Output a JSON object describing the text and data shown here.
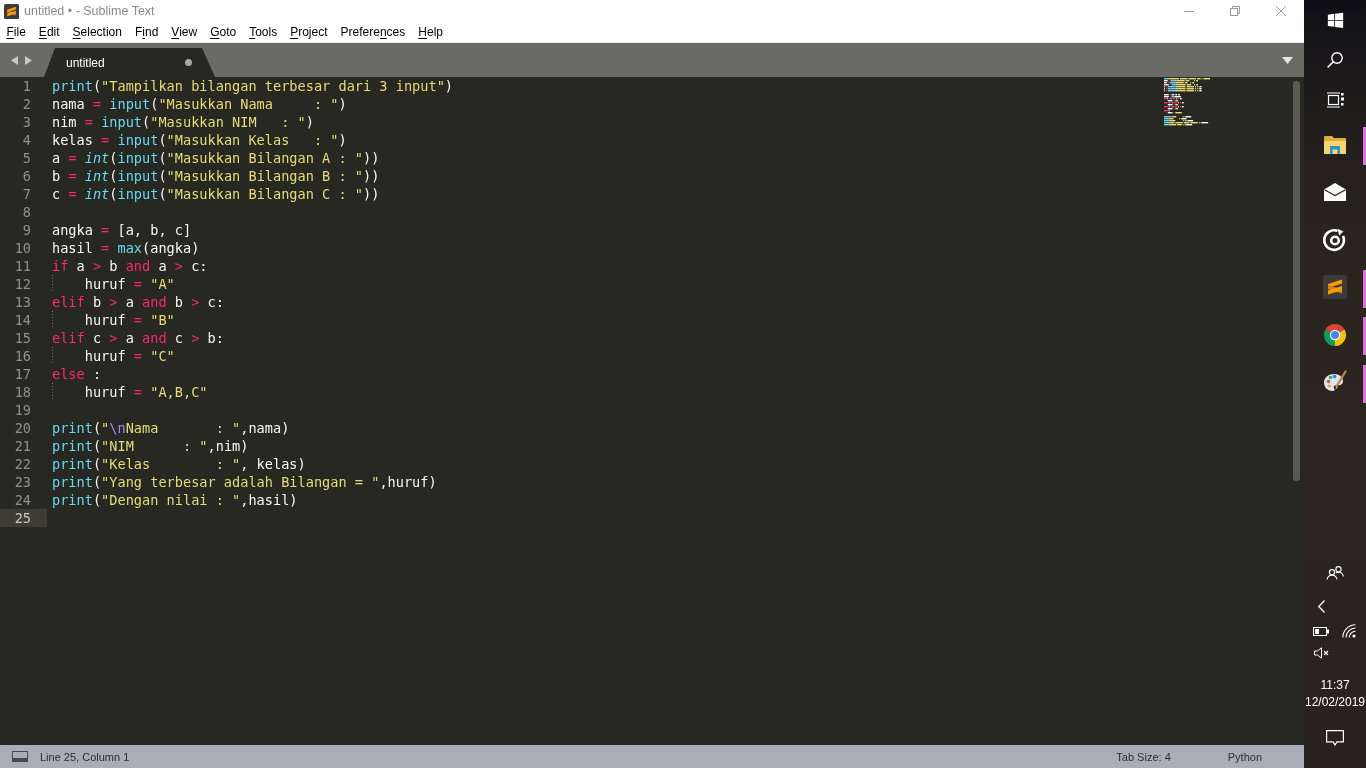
{
  "window": {
    "title": "untitled • - Sublime Text"
  },
  "menu": [
    {
      "key": "F",
      "post": "ile"
    },
    {
      "key": "E",
      "post": "dit"
    },
    {
      "key": "S",
      "post": "election"
    },
    {
      "pre": "F",
      "key": "i",
      "post": "nd"
    },
    {
      "key": "V",
      "post": "iew"
    },
    {
      "key": "G",
      "post": "oto"
    },
    {
      "key": "T",
      "post": "ools"
    },
    {
      "key": "P",
      "post": "roject"
    },
    {
      "pre": "Prefere",
      "key": "n",
      "post": "ces"
    },
    {
      "key": "H",
      "post": "elp"
    }
  ],
  "tabs": [
    {
      "label": "untitled",
      "selected": true,
      "dirty": true
    }
  ],
  "editor": {
    "lines": [
      {
        "number": "1",
        "current": false,
        "guide": false,
        "tokens": [
          {
            "kind": "function",
            "text": "print"
          },
          {
            "kind": "plain",
            "text": "("
          },
          {
            "kind": "string",
            "text": "\"Tampilkan bilangan terbesar dari 3 input\""
          },
          {
            "kind": "plain",
            "text": ")"
          }
        ]
      },
      {
        "number": "2",
        "current": false,
        "guide": false,
        "tokens": [
          {
            "kind": "plain",
            "text": "nama "
          },
          {
            "kind": "operator",
            "text": "= "
          },
          {
            "kind": "function",
            "text": "input"
          },
          {
            "kind": "plain",
            "text": "("
          },
          {
            "kind": "string",
            "text": "\"Masukkan Nama     : \""
          },
          {
            "kind": "plain",
            "text": ")"
          }
        ]
      },
      {
        "number": "3",
        "current": false,
        "guide": false,
        "tokens": [
          {
            "kind": "plain",
            "text": "nim "
          },
          {
            "kind": "operator",
            "text": "= "
          },
          {
            "kind": "function",
            "text": "input"
          },
          {
            "kind": "plain",
            "text": "("
          },
          {
            "kind": "string",
            "text": "\"Masukkan NIM   : \""
          },
          {
            "kind": "plain",
            "text": ")"
          }
        ]
      },
      {
        "number": "4",
        "current": false,
        "guide": false,
        "tokens": [
          {
            "kind": "plain",
            "text": "kelas "
          },
          {
            "kind": "operator",
            "text": "= "
          },
          {
            "kind": "function",
            "text": "input"
          },
          {
            "kind": "plain",
            "text": "("
          },
          {
            "kind": "string",
            "text": "\"Masukkan Kelas   : \""
          },
          {
            "kind": "plain",
            "text": ")"
          }
        ]
      },
      {
        "number": "5",
        "current": false,
        "guide": false,
        "tokens": [
          {
            "kind": "plain",
            "text": "a "
          },
          {
            "kind": "operator",
            "text": "= "
          },
          {
            "kind": "type",
            "text": "int"
          },
          {
            "kind": "plain",
            "text": "("
          },
          {
            "kind": "function",
            "text": "input"
          },
          {
            "kind": "plain",
            "text": "("
          },
          {
            "kind": "string",
            "text": "\"Masukkan Bilangan A : \""
          },
          {
            "kind": "plain",
            "text": "))"
          }
        ]
      },
      {
        "number": "6",
        "current": false,
        "guide": false,
        "tokens": [
          {
            "kind": "plain",
            "text": "b "
          },
          {
            "kind": "operator",
            "text": "= "
          },
          {
            "kind": "type",
            "text": "int"
          },
          {
            "kind": "plain",
            "text": "("
          },
          {
            "kind": "function",
            "text": "input"
          },
          {
            "kind": "plain",
            "text": "("
          },
          {
            "kind": "string",
            "text": "\"Masukkan Bilangan B : \""
          },
          {
            "kind": "plain",
            "text": "))"
          }
        ]
      },
      {
        "number": "7",
        "current": false,
        "guide": false,
        "tokens": [
          {
            "kind": "plain",
            "text": "c "
          },
          {
            "kind": "operator",
            "text": "= "
          },
          {
            "kind": "type",
            "text": "int"
          },
          {
            "kind": "plain",
            "text": "("
          },
          {
            "kind": "function",
            "text": "input"
          },
          {
            "kind": "plain",
            "text": "("
          },
          {
            "kind": "string",
            "text": "\"Masukkan Bilangan C : \""
          },
          {
            "kind": "plain",
            "text": "))"
          }
        ]
      },
      {
        "number": "8",
        "current": false,
        "guide": false
      },
      {
        "number": "9",
        "current": false,
        "guide": false,
        "tokens": [
          {
            "kind": "plain",
            "text": "angka "
          },
          {
            "kind": "operator",
            "text": "="
          },
          {
            "kind": "plain",
            "text": " [a, b, c]"
          }
        ]
      },
      {
        "number": "10",
        "current": false,
        "guide": false,
        "tokens": [
          {
            "kind": "plain",
            "text": "hasil "
          },
          {
            "kind": "operator",
            "text": "= "
          },
          {
            "kind": "function",
            "text": "max"
          },
          {
            "kind": "plain",
            "text": "(angka)"
          }
        ]
      },
      {
        "number": "11",
        "current": false,
        "guide": false,
        "tokens": [
          {
            "kind": "keyword",
            "text": "if"
          },
          {
            "kind": "plain",
            "text": " a "
          },
          {
            "kind": "operator",
            "text": ">"
          },
          {
            "kind": "plain",
            "text": " b "
          },
          {
            "kind": "keyword",
            "text": "and"
          },
          {
            "kind": "plain",
            "text": " a "
          },
          {
            "kind": "operator",
            "text": ">"
          },
          {
            "kind": "plain",
            "text": " c:"
          }
        ]
      },
      {
        "number": "12",
        "current": false,
        "guide": true,
        "tokens": [
          {
            "kind": "plain",
            "text": "    huruf "
          },
          {
            "kind": "operator",
            "text": "= "
          },
          {
            "kind": "string",
            "text": "\"A\""
          }
        ]
      },
      {
        "number": "13",
        "current": false,
        "guide": false,
        "tokens": [
          {
            "kind": "keyword",
            "text": "elif"
          },
          {
            "kind": "plain",
            "text": " b "
          },
          {
            "kind": "operator",
            "text": ">"
          },
          {
            "kind": "plain",
            "text": " a "
          },
          {
            "kind": "keyword",
            "text": "and"
          },
          {
            "kind": "plain",
            "text": " b "
          },
          {
            "kind": "operator",
            "text": ">"
          },
          {
            "kind": "plain",
            "text": " c:"
          }
        ]
      },
      {
        "number": "14",
        "current": false,
        "guide": true,
        "tokens": [
          {
            "kind": "plain",
            "text": "    huruf "
          },
          {
            "kind": "operator",
            "text": "= "
          },
          {
            "kind": "string",
            "text": "\"B\""
          }
        ]
      },
      {
        "number": "15",
        "current": false,
        "guide": false,
        "tokens": [
          {
            "kind": "keyword",
            "text": "elif"
          },
          {
            "kind": "plain",
            "text": " c "
          },
          {
            "kind": "operator",
            "text": ">"
          },
          {
            "kind": "plain",
            "text": " a "
          },
          {
            "kind": "keyword",
            "text": "and"
          },
          {
            "kind": "plain",
            "text": " c "
          },
          {
            "kind": "operator",
            "text": ">"
          },
          {
            "kind": "plain",
            "text": " b:"
          }
        ]
      },
      {
        "number": "16",
        "current": false,
        "guide": true,
        "tokens": [
          {
            "kind": "plain",
            "text": "    huruf "
          },
          {
            "kind": "operator",
            "text": "= "
          },
          {
            "kind": "string",
            "text": "\"C\""
          }
        ]
      },
      {
        "number": "17",
        "current": false,
        "guide": false,
        "tokens": [
          {
            "kind": "keyword",
            "text": "else"
          },
          {
            "kind": "plain",
            "text": " :"
          }
        ]
      },
      {
        "number": "18",
        "current": false,
        "guide": true,
        "tokens": [
          {
            "kind": "plain",
            "text": "    huruf "
          },
          {
            "kind": "operator",
            "text": "= "
          },
          {
            "kind": "string",
            "text": "\"A,B,C\""
          }
        ]
      },
      {
        "number": "19",
        "current": false,
        "guide": false
      },
      {
        "number": "20",
        "current": false,
        "guide": false,
        "tokens": [
          {
            "kind": "function",
            "text": "print"
          },
          {
            "kind": "plain",
            "text": "("
          },
          {
            "kind": "string",
            "text": "\""
          },
          {
            "kind": "escape",
            "text": "\\n"
          },
          {
            "kind": "string",
            "text": "Nama       : \""
          },
          {
            "kind": "plain",
            "text": ",nama)"
          }
        ]
      },
      {
        "number": "21",
        "current": false,
        "guide": false,
        "tokens": [
          {
            "kind": "function",
            "text": "print"
          },
          {
            "kind": "plain",
            "text": "("
          },
          {
            "kind": "string",
            "text": "\"NIM      : \""
          },
          {
            "kind": "plain",
            "text": ",nim)"
          }
        ]
      },
      {
        "number": "22",
        "current": false,
        "guide": false,
        "tokens": [
          {
            "kind": "function",
            "text": "print"
          },
          {
            "kind": "plain",
            "text": "("
          },
          {
            "kind": "string",
            "text": "\"Kelas        : \""
          },
          {
            "kind": "plain",
            "text": ", kelas)"
          }
        ]
      },
      {
        "number": "23",
        "current": false,
        "guide": false,
        "tokens": [
          {
            "kind": "function",
            "text": "print"
          },
          {
            "kind": "plain",
            "text": "("
          },
          {
            "kind": "string",
            "text": "\"Yang terbesar adalah Bilangan = \""
          },
          {
            "kind": "plain",
            "text": ",huruf)"
          }
        ]
      },
      {
        "number": "24",
        "current": false,
        "guide": false,
        "tokens": [
          {
            "kind": "function",
            "text": "print"
          },
          {
            "kind": "plain",
            "text": "("
          },
          {
            "kind": "string",
            "text": "\"Dengan nilai : \""
          },
          {
            "kind": "plain",
            "text": ",hasil)"
          }
        ]
      },
      {
        "number": "25",
        "current": true,
        "guide": false
      }
    ]
  },
  "status_bar": {
    "position": "Line 25, Column 1",
    "tab_size": "Tab Size: 4",
    "syntax": "Python"
  },
  "taskbar": {
    "apps": [
      {
        "kind": "folder",
        "running": true
      },
      {
        "kind": "envelope",
        "running": false
      },
      {
        "kind": "ring",
        "running": false
      },
      {
        "kind": "logo",
        "running": true
      },
      {
        "kind": "browser",
        "running": true
      },
      {
        "kind": "palette",
        "running": true
      }
    ],
    "clock": {
      "time": "11:37",
      "date": "12/02/2019"
    }
  }
}
